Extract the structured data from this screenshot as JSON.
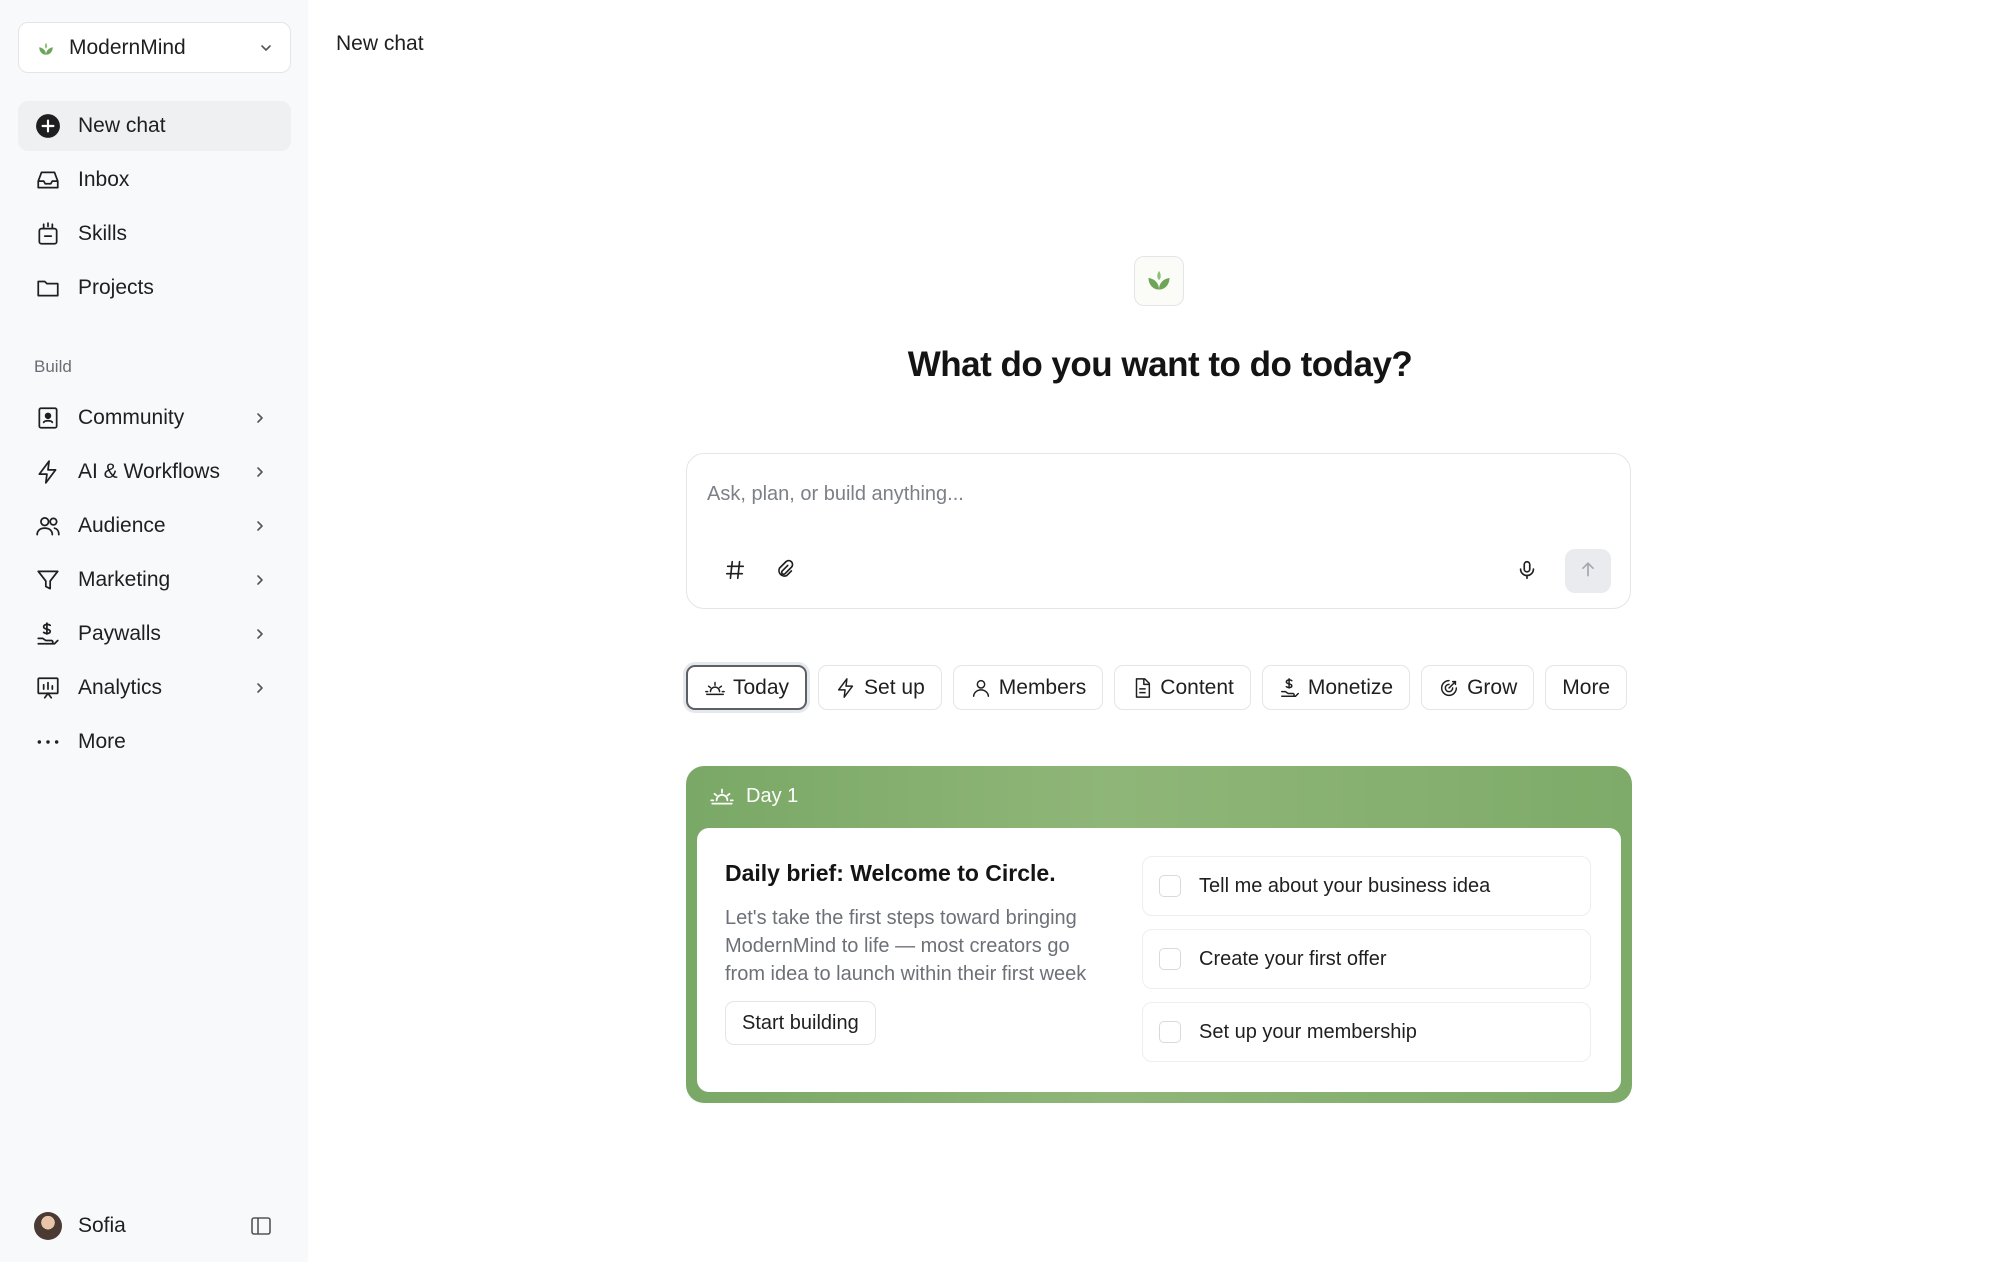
{
  "workspace": {
    "name": "ModernMind",
    "icon": "leaf-logo-icon"
  },
  "header": {
    "title": "New chat"
  },
  "sidebar": {
    "primary": [
      {
        "label": "New chat",
        "icon": "plus-circle-icon"
      },
      {
        "label": "Inbox",
        "icon": "inbox-icon"
      },
      {
        "label": "Skills",
        "icon": "skills-icon"
      },
      {
        "label": "Projects",
        "icon": "folder-icon"
      }
    ],
    "section_label": "Build",
    "build": [
      {
        "label": "Community",
        "icon": "community-icon"
      },
      {
        "label": "AI & Workflows",
        "icon": "lightning-icon"
      },
      {
        "label": "Audience",
        "icon": "users-icon"
      },
      {
        "label": "Marketing",
        "icon": "funnel-icon"
      },
      {
        "label": "Paywalls",
        "icon": "paywall-icon"
      },
      {
        "label": "Analytics",
        "icon": "analytics-icon"
      },
      {
        "label": "More",
        "icon": "dots-icon"
      }
    ],
    "user": {
      "name": "Sofia"
    }
  },
  "main": {
    "headline": "What do you want to do today?",
    "composer": {
      "placeholder": "Ask, plan, or build anything..."
    },
    "chips": [
      {
        "label": "Today",
        "icon": "sunrise-icon",
        "selected": true
      },
      {
        "label": "Set up",
        "icon": "lightning-icon"
      },
      {
        "label": "Members",
        "icon": "user-icon"
      },
      {
        "label": "Content",
        "icon": "document-icon"
      },
      {
        "label": "Monetize",
        "icon": "money-icon"
      },
      {
        "label": "Grow",
        "icon": "target-icon"
      },
      {
        "label": "More"
      }
    ],
    "day_card": {
      "day_label": "Day 1",
      "title": "Daily brief: Welcome to Circle.",
      "body": "Let's take the first steps toward bringing ModernMind to life — most creators go from idea to launch within their first week",
      "button": "Start building",
      "tasks": [
        "Tell me about your business idea",
        "Create your first offer",
        "Set up your membership"
      ]
    }
  },
  "colors": {
    "brand_green": "#6fa558",
    "card_green": "#86b271",
    "sidebar_bg": "#f8f9fa"
  }
}
